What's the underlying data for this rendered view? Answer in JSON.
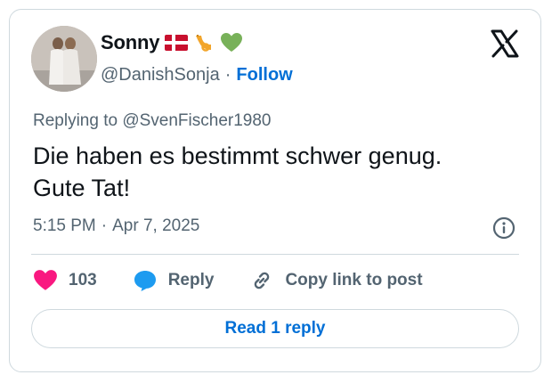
{
  "author": {
    "name": "Sonny",
    "handle": "@DanishSonja",
    "emojis": [
      "danish-flag-icon",
      "horn-icon",
      "green-heart-icon"
    ],
    "separator": "·",
    "follow_label": "Follow"
  },
  "reply_context": {
    "text": "Replying to @SvenFischer1980"
  },
  "tweet": {
    "text_line1": "Die haben es bestimmt schwer genug.",
    "text_line2": "Gute Tat!"
  },
  "meta": {
    "time": "5:15 PM",
    "separator": "·",
    "date": "Apr 7, 2025"
  },
  "actions": {
    "like_count": "103",
    "reply_label": "Reply",
    "copy_link_label": "Copy link to post"
  },
  "read_replies_label": "Read 1 reply",
  "colors": {
    "accent": "#006fd6",
    "like": "#f91880",
    "reply_bubble": "#1d9bf0",
    "border": "#cfd9de",
    "muted": "#536471",
    "text": "#0f1419"
  }
}
